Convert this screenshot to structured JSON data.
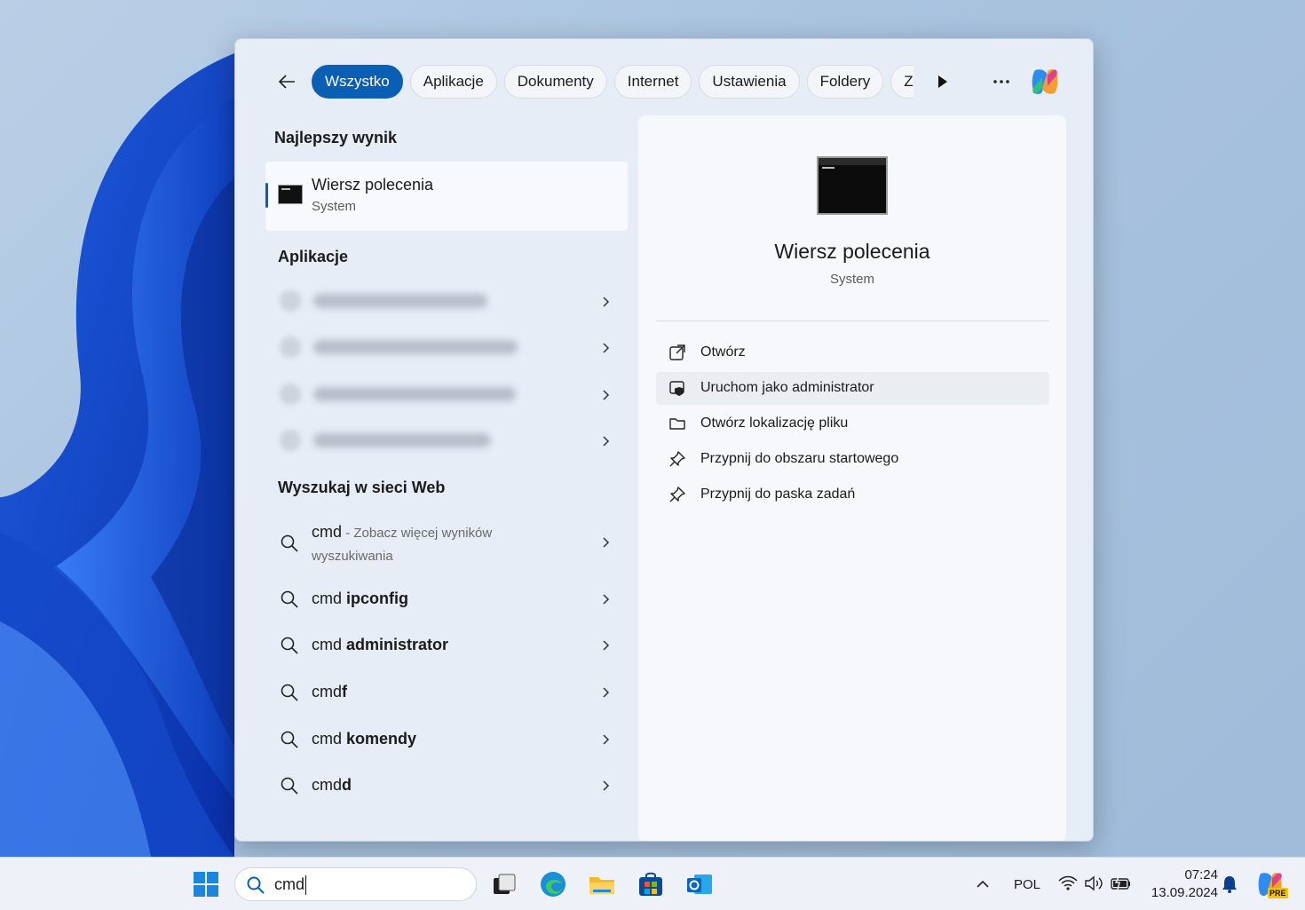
{
  "search_flyout": {
    "filters": [
      "Wszystko",
      "Aplikacje",
      "Dokumenty",
      "Internet",
      "Ustawienia",
      "Foldery",
      "Zdjęcia"
    ],
    "active_filter": "Wszystko",
    "icons": {
      "back": "back-arrow-icon",
      "next": "play-next-icon",
      "more": "more-icon",
      "copilot": "copilot-icon"
    }
  },
  "best_match": {
    "heading": "Najlepszy wynik",
    "name": "Wiersz polecenia",
    "type": "System"
  },
  "apps": {
    "heading": "Aplikacje",
    "items_blurred": 4
  },
  "web_search": {
    "heading": "Wyszukaj w sieci Web",
    "items": [
      {
        "prefix": "cmd",
        "bold": "",
        "hint": " - Zobacz więcej wyników",
        "hint2": "wyszukiwania"
      },
      {
        "prefix": "cmd ",
        "bold": "ipconfig"
      },
      {
        "prefix": "cmd ",
        "bold": "administrator"
      },
      {
        "prefix": "cmd",
        "bold": "f"
      },
      {
        "prefix": "cmd ",
        "bold": "komendy"
      },
      {
        "prefix": "cmd",
        "bold": "d"
      }
    ]
  },
  "details": {
    "title": "Wiersz polecenia",
    "subtitle": "System",
    "actions": [
      {
        "label": "Otwórz",
        "icon": "open-external-icon"
      },
      {
        "label": "Uruchom jako administrator",
        "icon": "shield-admin-icon"
      },
      {
        "label": "Otwórz lokalizację pliku",
        "icon": "folder-icon"
      },
      {
        "label": "Przypnij do obszaru startowego",
        "icon": "pin-icon"
      },
      {
        "label": "Przypnij do paska zadań",
        "icon": "pin-icon"
      }
    ]
  },
  "taskbar": {
    "search_value": "cmd",
    "language": "POL",
    "time": "07:24",
    "date": "13.09.2024",
    "copilot_badge": "PRE",
    "apps": [
      "windows-start-icon",
      "task-view-icon",
      "edge-icon",
      "file-explorer-icon",
      "store-icon",
      "outlook-icon"
    ]
  }
}
